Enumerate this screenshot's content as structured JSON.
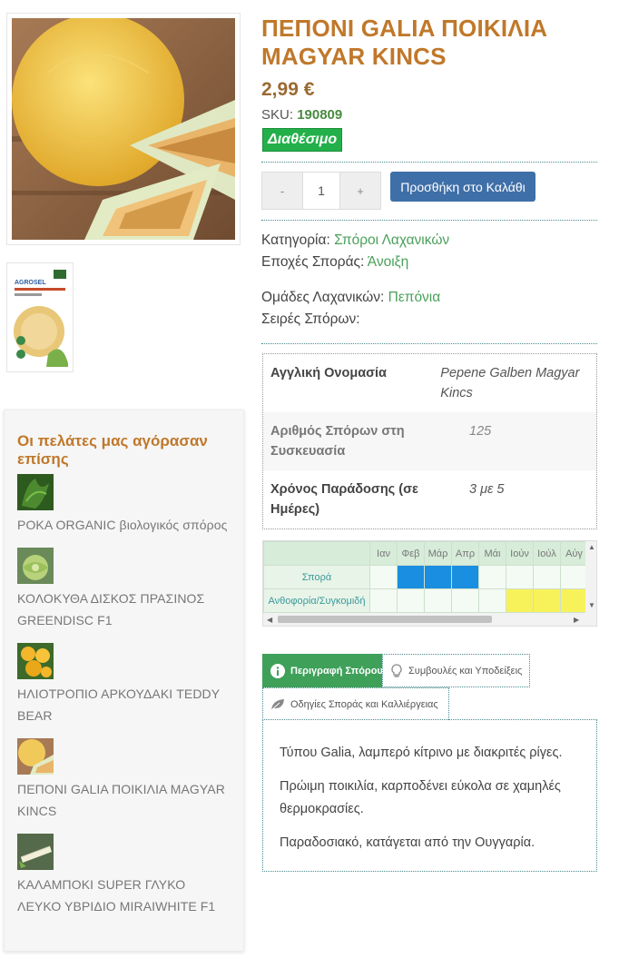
{
  "product": {
    "title": "ΠΕΠΟΝΙ GALIA ΠΟΙΚΙΛΙΑ MAGYAR KINCS",
    "price": "2,99 €",
    "sku_label": "SKU:",
    "sku_value": "190809",
    "stock": "Διαθέσιμο",
    "qty_minus": "-",
    "qty_value": "1",
    "qty_plus": "+",
    "add_to_cart": "Προσθήκη στο Καλάθι"
  },
  "meta": {
    "category_label": "Κατηγορία:",
    "category_value": "Σπόροι Λαχανικών",
    "season_label": "Εποχές Σποράς:",
    "season_value": "Άνοιξη",
    "groups_label": "Ομάδες Λαχανικών:",
    "groups_value": "Πεπόνια",
    "series_label": "Σειρές Σπόρων:"
  },
  "attributes": [
    {
      "key": "Αγγλική Ονομασία",
      "value": "Pepene Galben Magyar Kincs"
    },
    {
      "key": "Αριθμός Σπόρων στη Συσκευασία",
      "value": "125"
    },
    {
      "key": "Χρόνος Παράδοσης (σε Ημέρες)",
      "value": "3 με 5"
    }
  ],
  "calendar": {
    "months": [
      "Ιαν",
      "Φεβ",
      "Μάρ",
      "Απρ",
      "Μάι",
      "Ιούν",
      "Ιούλ",
      "Αύγ"
    ],
    "rows": [
      {
        "label": "Σπορά",
        "active": [
          1,
          2,
          3
        ],
        "color": "#1a8ee0"
      },
      {
        "label": "Ανθοφορία/Συγκομιδή",
        "active": [
          5,
          6,
          7
        ],
        "color": "#f7f25a"
      }
    ]
  },
  "tabs": {
    "description": "Περιγραφή Σπόρου",
    "tips": "Συμβουλές και Υποδείξεις",
    "instructions": "Οδηγίες Σποράς και Καλλιέργειας"
  },
  "description": [
    "Τύπου Galia, λαμπερό κίτρινο με διακριτές ρίγες.",
    "Πρώιμη ποικιλία, καρποδένει εύκολα σε χαμηλές θερμοκρασίες.",
    "Παραδοσιακό, κατάγεται από την Ουγγαρία."
  ],
  "sidebar": {
    "title": "Οι πελάτες μας αγόρασαν επίσης",
    "items": [
      {
        "name": "ΡΟΚΑ ORGANIC βιολογικός σπόρος"
      },
      {
        "name": "ΚΟΛΟΚΥΘΑ ΔΙΣΚΟΣ ΠΡΑΣΙΝΟΣ GREENDISC F1"
      },
      {
        "name": "ΗΛΙΟΤΡΟΠΙΟ ΑΡΚΟΥΔΑΚΙ TEDDY BEAR"
      },
      {
        "name": "ΠΕΠΟΝΙ GALIA ΠΟΙΚΙΛΙΑ MAGYAR KINCS"
      },
      {
        "name": "ΚΑΛΑΜΠΟΚΙ SUPER ΓΛΥΚΟ ΛΕΥΚΟ ΥΒΡΙΔΙΟ MIRAIWHITE F1"
      }
    ]
  },
  "thumb_logo": "AGROSEL"
}
